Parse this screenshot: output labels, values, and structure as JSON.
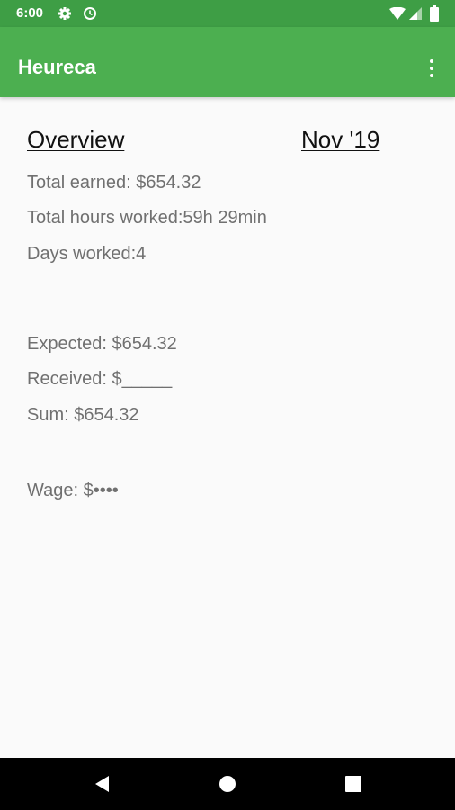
{
  "status": {
    "time": "6:00"
  },
  "app": {
    "title": "Heureca"
  },
  "overview": {
    "heading": "Overview",
    "month": "Nov '19",
    "total_earned": "Total earned: $654.32",
    "total_hours": "Total hours worked:59h 29min",
    "days_worked": "Days worked:4",
    "expected": "Expected: $654.32",
    "received": "Received: $_____",
    "sum": "Sum: $654.32",
    "wage": "Wage: $••••"
  },
  "colors": {
    "app_bar": "#4caf50",
    "status_bar": "#3e9e45",
    "background": "#fafafa"
  }
}
